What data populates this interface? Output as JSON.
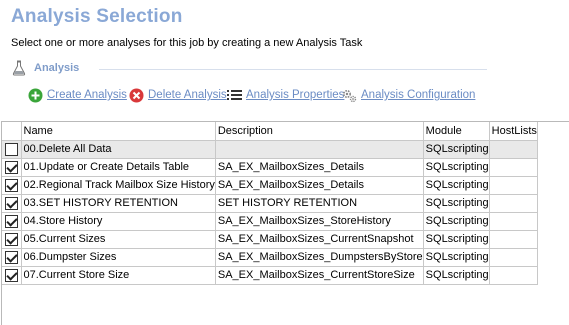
{
  "header": {
    "title": "Analysis Selection",
    "subtitle": "Select one or more analyses for this job by creating a new Analysis Task"
  },
  "section": {
    "label": "Analysis",
    "icon": "flask-icon"
  },
  "toolbar": {
    "create": "Create Analysis",
    "delete": "Delete Analysis",
    "properties": "Analysis Properties",
    "configuration": "Analysis Configuration"
  },
  "colors": {
    "title": "#8aa8d6",
    "link": "#6b8cc4",
    "create_icon": "#3aa53a",
    "delete_icon": "#d9383a",
    "selected_row": "#e9e9e9"
  },
  "grid": {
    "columns": [
      "Name",
      "Description",
      "Module",
      "HostLists"
    ],
    "rows": [
      {
        "checked": false,
        "name": "00.Delete All Data",
        "description": "",
        "module": "SQLscripting",
        "hostlists": ""
      },
      {
        "checked": true,
        "name": "01.Update or Create Details Table",
        "description": "SA_EX_MailboxSizes_Details",
        "module": "SQLscripting",
        "hostlists": ""
      },
      {
        "checked": true,
        "name": "02.Regional Track Mailbox Size History",
        "description": "SA_EX_MailboxSizes_Details",
        "module": "SQLscripting",
        "hostlists": ""
      },
      {
        "checked": true,
        "name": "03.SET HISTORY RETENTION",
        "description": "SET HISTORY RETENTION",
        "module": "SQLscripting",
        "hostlists": ""
      },
      {
        "checked": true,
        "name": "04.Store History",
        "description": "SA_EX_MailboxSizes_StoreHistory",
        "module": "SQLscripting",
        "hostlists": ""
      },
      {
        "checked": true,
        "name": "05.Current Sizes",
        "description": "SA_EX_MailboxSizes_CurrentSnapshot",
        "module": "SQLscripting",
        "hostlists": ""
      },
      {
        "checked": true,
        "name": "06.Dumpster Sizes",
        "description": "SA_EX_MailboxSizes_DumpstersByStore",
        "module": "SQLscripting",
        "hostlists": ""
      },
      {
        "checked": true,
        "name": "07.Current Store Size",
        "description": "SA_EX_MailboxSizes_CurrentStoreSize",
        "module": "SQLscripting",
        "hostlists": ""
      }
    ]
  }
}
